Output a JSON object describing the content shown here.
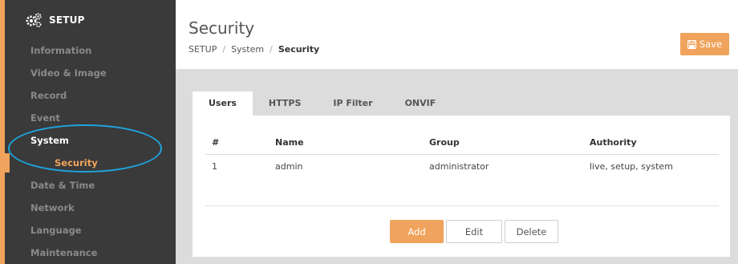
{
  "sidebar": {
    "header": {
      "label": "SETUP",
      "icon": "gears-icon"
    },
    "items": [
      {
        "label": "Information"
      },
      {
        "label": "Video & Image"
      },
      {
        "label": "Record"
      },
      {
        "label": "Event"
      },
      {
        "label": "System"
      },
      {
        "label": "Security"
      },
      {
        "label": "Date & Time"
      },
      {
        "label": "Network"
      },
      {
        "label": "Language"
      },
      {
        "label": "Maintenance"
      }
    ],
    "active_item": "System",
    "current_subitem": "Security"
  },
  "header": {
    "title": "Security",
    "breadcrumb": [
      "SETUP",
      "System",
      "Security"
    ],
    "breadcrumb_separator": "/",
    "save_label": "Save",
    "save_icon": "floppy-disk-icon"
  },
  "tabs": [
    {
      "label": "Users"
    },
    {
      "label": "HTTPS"
    },
    {
      "label": "IP Filter"
    },
    {
      "label": "ONVIF"
    }
  ],
  "active_tab": "Users",
  "table": {
    "columns": [
      "#",
      "Name",
      "Group",
      "Authority"
    ],
    "rows": [
      [
        "1",
        "admin",
        "administrator",
        "live, setup, system"
      ]
    ]
  },
  "actions": {
    "add": "Add",
    "edit": "Edit",
    "delete": "Delete"
  },
  "colors": {
    "accent": "#f0a35c",
    "sidebar_bg": "#3a3a3a",
    "annotation_ellipse": "#1fa3dd",
    "panel_bg": "#dcdcdc"
  }
}
